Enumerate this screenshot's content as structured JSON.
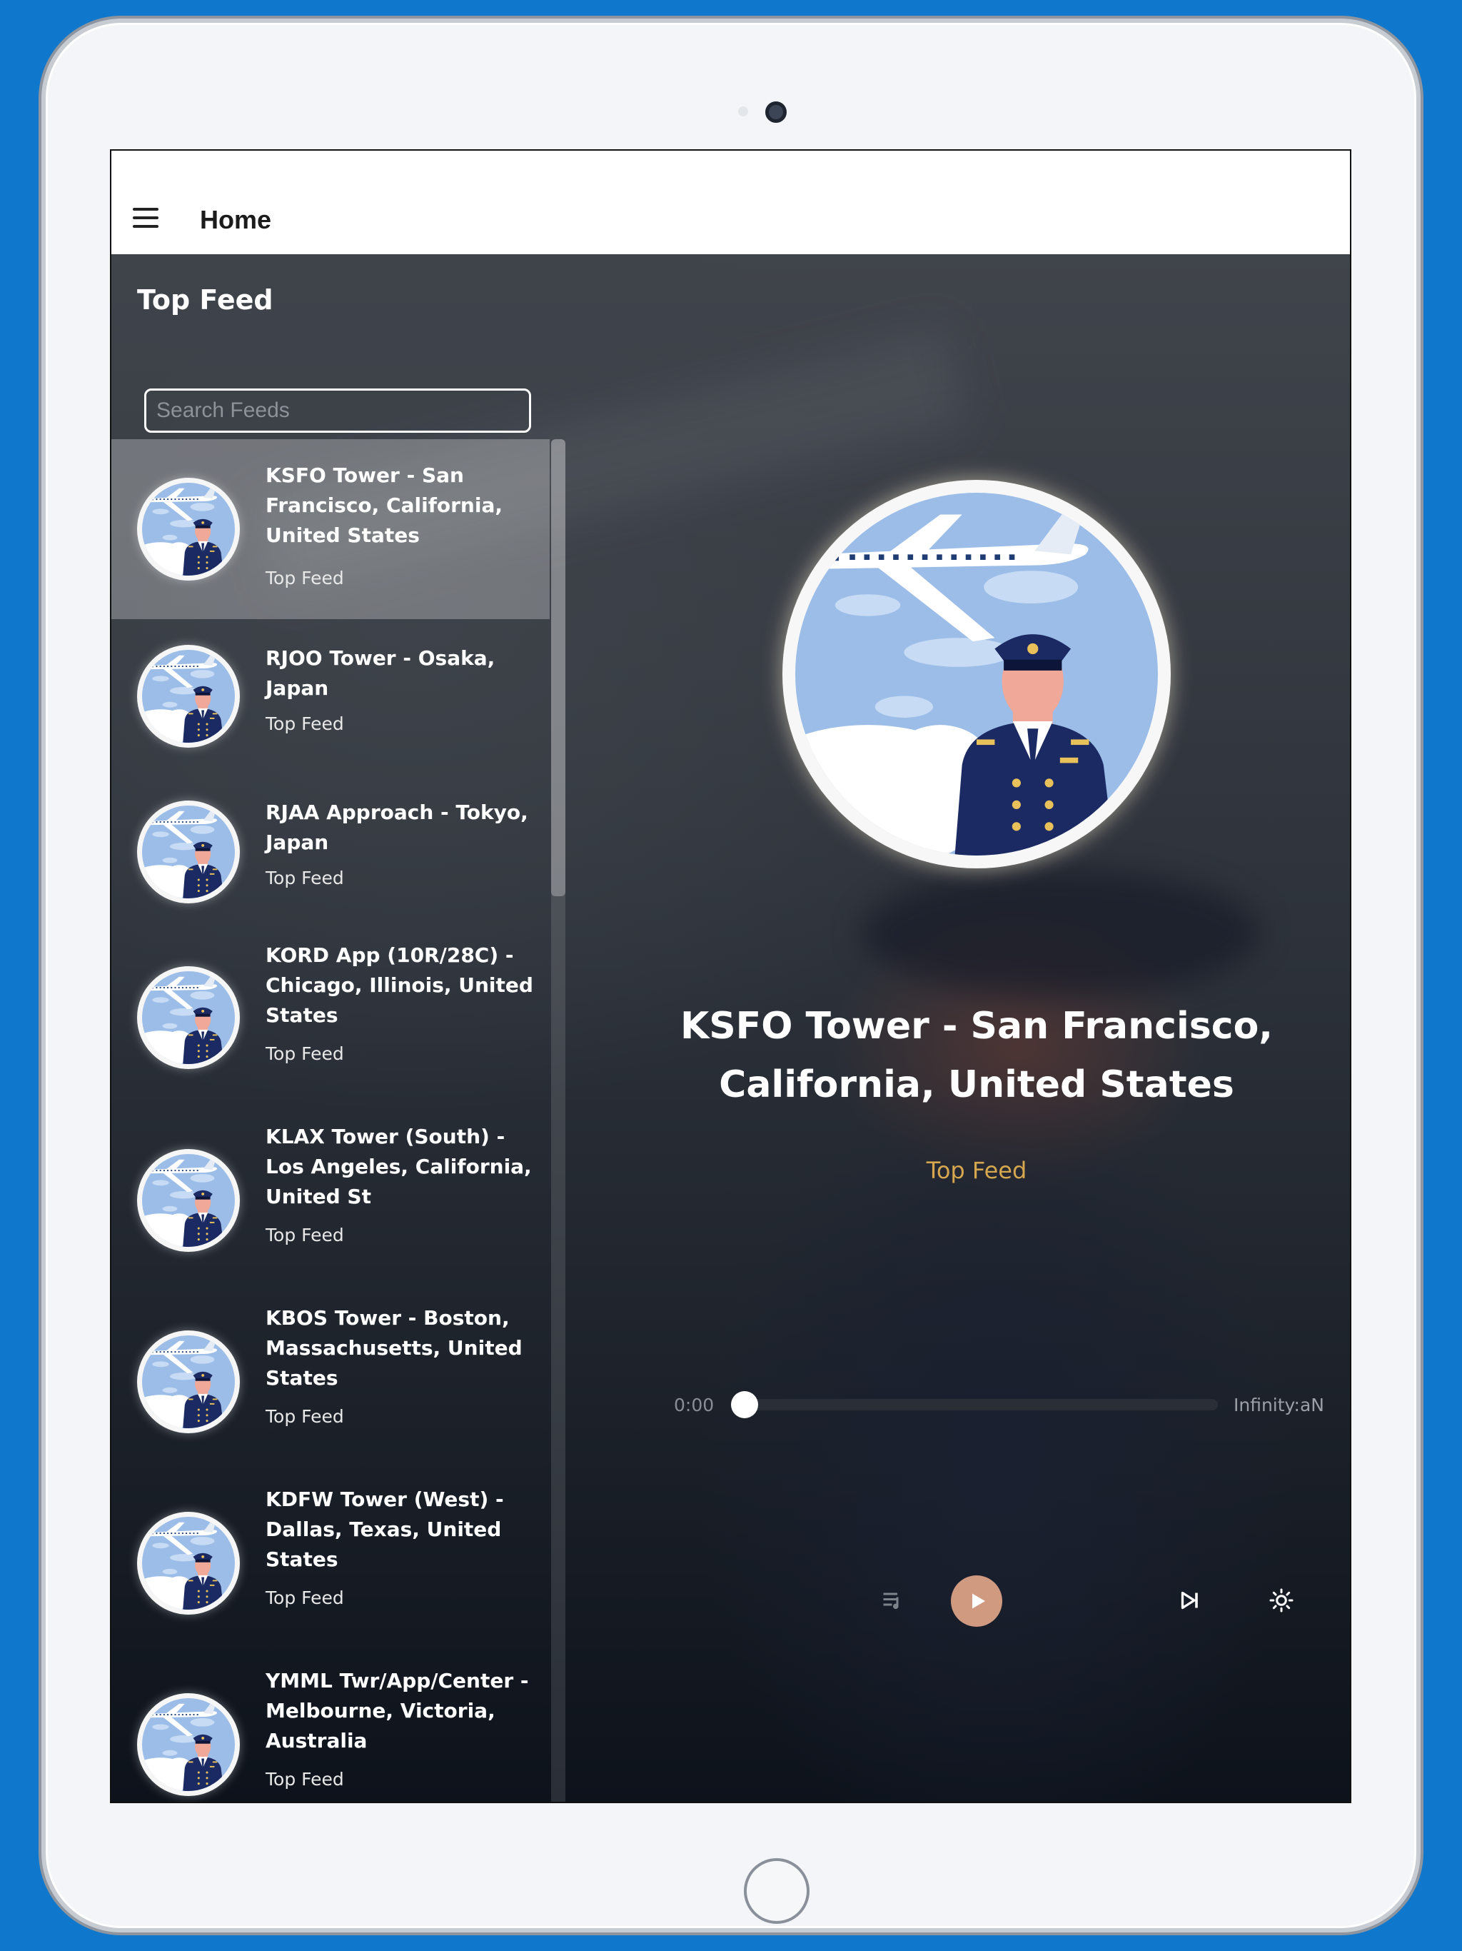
{
  "appbar": {
    "title": "Home"
  },
  "panel": {
    "title": "Top Feed",
    "search_placeholder": "Search Feeds"
  },
  "feeds": [
    {
      "name": "KSFO Tower - San Francisco, California, United States",
      "category": "Top Feed"
    },
    {
      "name": "RJOO Tower - Osaka, Japan",
      "category": "Top Feed"
    },
    {
      "name": "RJAA Approach - Tokyo, Japan",
      "category": "Top Feed"
    },
    {
      "name": "KORD App (10R/28C) - Chicago, Illinois, United States",
      "category": "Top Feed"
    },
    {
      "name": "KLAX Tower (South) - Los Angeles, California, United St",
      "category": "Top Feed"
    },
    {
      "name": "KBOS Tower - Boston, Massachusetts, United States",
      "category": "Top Feed"
    },
    {
      "name": "KDFW Tower (West) - Dallas, Texas, United States",
      "category": "Top Feed"
    },
    {
      "name": "YMML Twr/App/Center - Melbourne, Victoria, Australia",
      "category": "Top Feed"
    }
  ],
  "player": {
    "title": "KSFO Tower - San Francisco, California, United States",
    "category": "Top Feed",
    "current_time": "0:00",
    "duration": "Infinity:aN",
    "progress": 0
  },
  "icons": {
    "menu": "menu-icon",
    "playlist": "playlist-icon",
    "previous": "skip-previous-icon",
    "play": "play-icon",
    "next": "skip-next-icon",
    "theme": "brightness-icon"
  },
  "colors": {
    "accent": "#d6a74e",
    "play_button": "#cf9a7f",
    "device_background": "#0f78cd"
  }
}
